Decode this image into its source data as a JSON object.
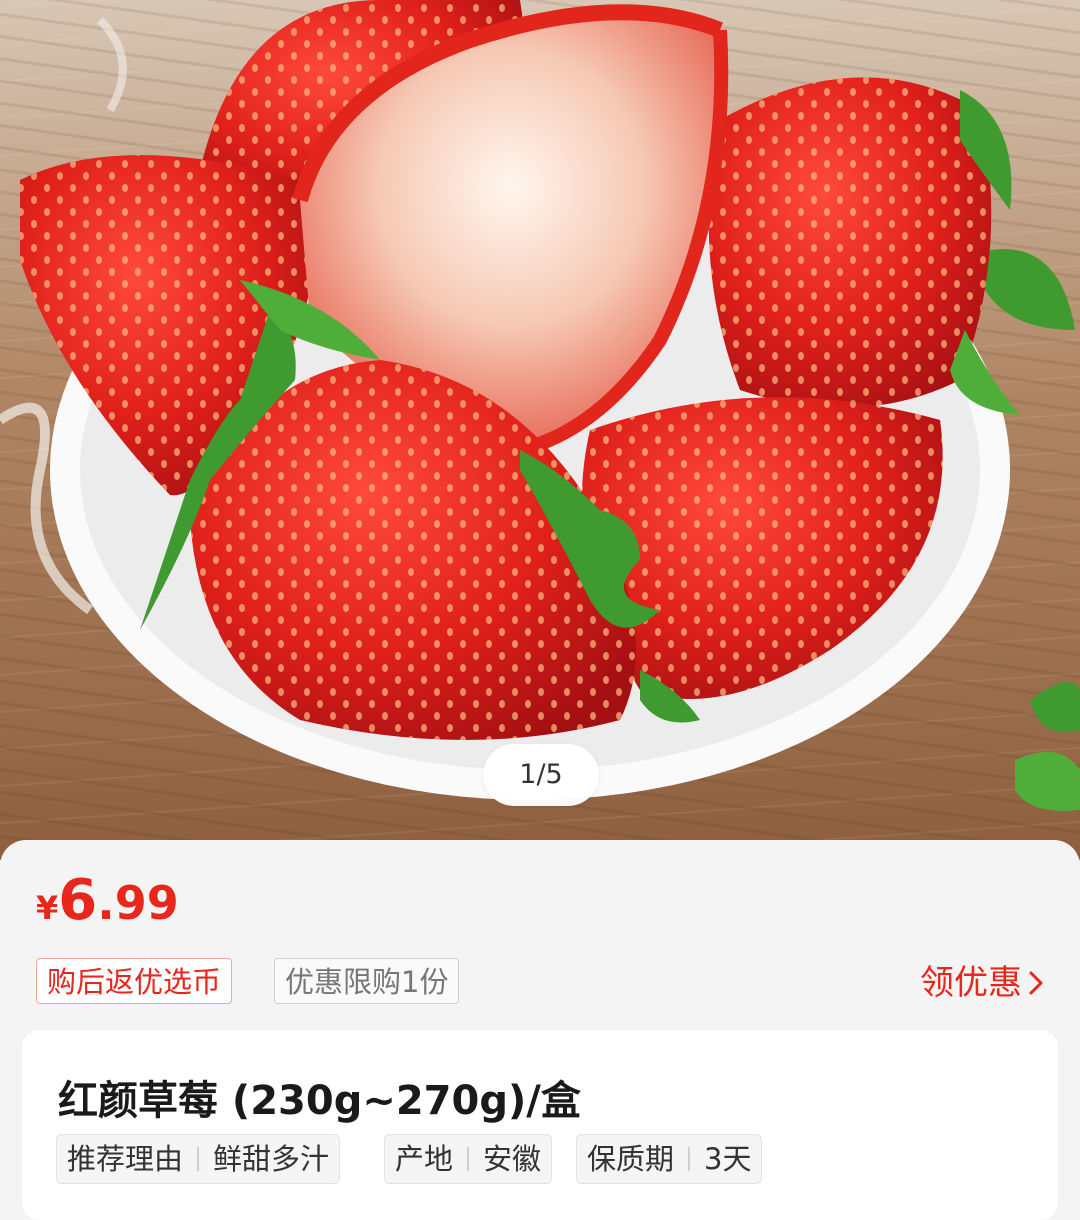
{
  "gallery": {
    "counter": "1/5",
    "image_description_icon": "strawberry-bowl-photo"
  },
  "product": {
    "price_symbol": "¥",
    "price_integer": "6",
    "price_decimal": ".99",
    "tags": [
      "购后返优选币",
      "优惠限购1份"
    ],
    "coupon_link": "领优惠",
    "title": "红颜草莓 (230g~270g)/盒",
    "attributes": [
      {
        "label": "推荐理由",
        "value": "鲜甜多汁"
      },
      {
        "label": "产地",
        "value": "安徽"
      },
      {
        "label": "保质期",
        "value": "3天"
      }
    ]
  },
  "colors": {
    "accent": "#e8261c",
    "strawberry": "#d81e1c",
    "leaf": "#3f9a2f"
  }
}
